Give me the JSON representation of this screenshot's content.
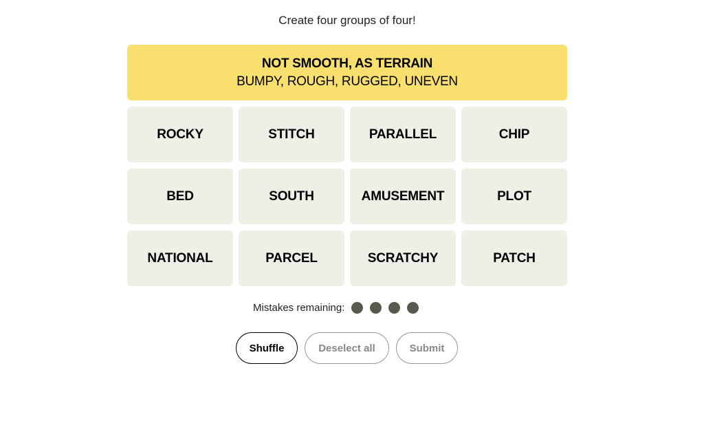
{
  "subtitle": "Create four groups of four!",
  "solved_groups": [
    {
      "category": "NOT SMOOTH, AS TERRAIN",
      "words": "BUMPY, ROUGH, RUGGED, UNEVEN",
      "color": "#f9df6d"
    }
  ],
  "tiles": [
    "ROCKY",
    "STITCH",
    "PARALLEL",
    "CHIP",
    "BED",
    "SOUTH",
    "AMUSEMENT",
    "PLOT",
    "NATIONAL",
    "PARCEL",
    "SCRATCHY",
    "PATCH"
  ],
  "mistakes": {
    "label": "Mistakes remaining:",
    "remaining": 4
  },
  "buttons": {
    "shuffle": "Shuffle",
    "deselect": "Deselect all",
    "submit": "Submit"
  }
}
